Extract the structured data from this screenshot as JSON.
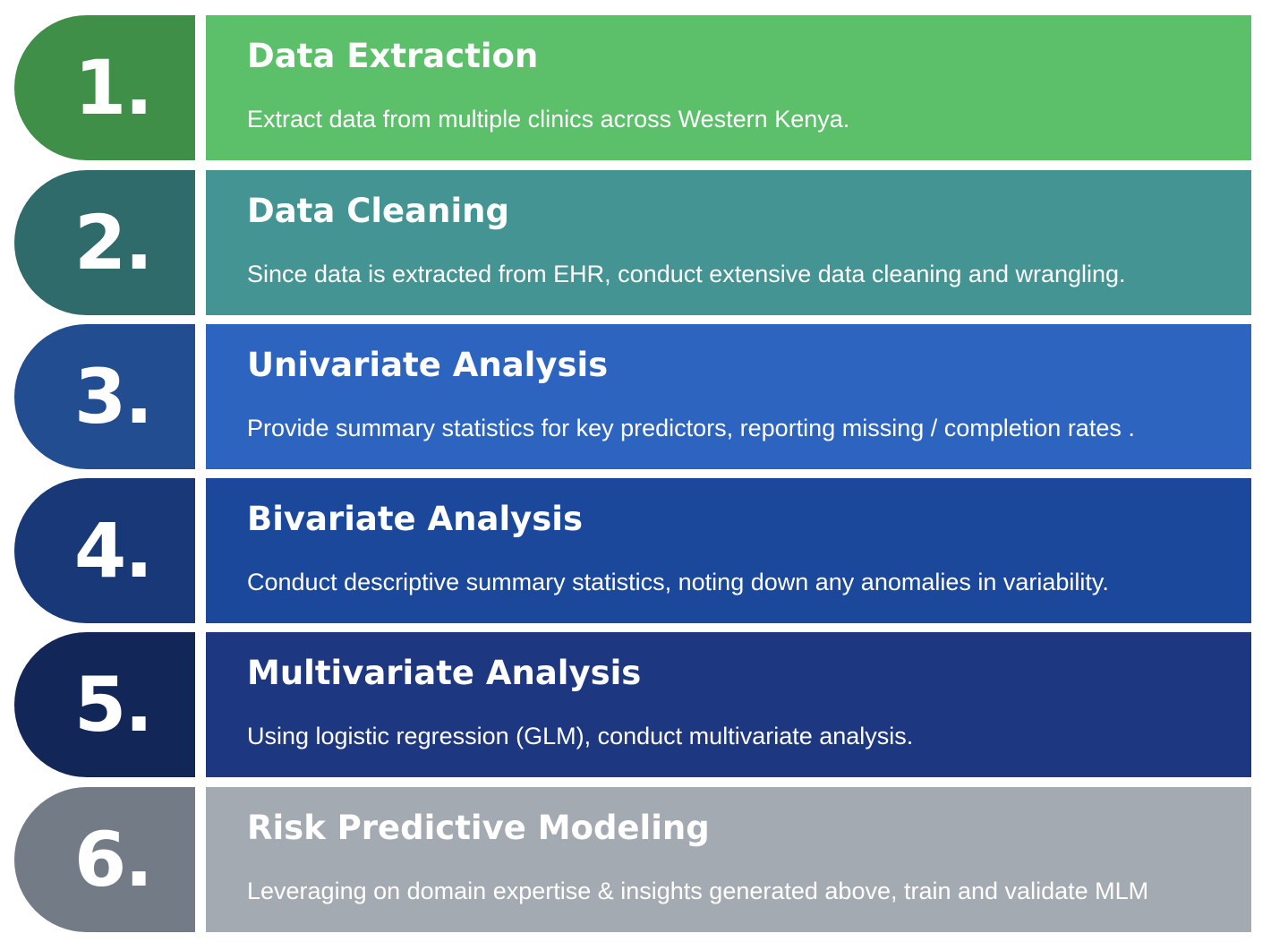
{
  "steps": [
    {
      "number": "1.",
      "title": "Data Extraction",
      "description": "Extract data from multiple clinics across Western Kenya.",
      "tab_color": "#3f8f49",
      "panel_color": "#5cbf6a"
    },
    {
      "number": "2.",
      "title": "Data Cleaning",
      "description": "Since data is extracted from EHR, conduct extensive data cleaning and wrangling.",
      "tab_color": "#2f6b6b",
      "panel_color": "#459494"
    },
    {
      "number": "3.",
      "title": "Univariate Analysis",
      "description": "Provide summary statistics for key predictors, reporting missing / completion rates .",
      "tab_color": "#234d91",
      "panel_color": "#2d64bf"
    },
    {
      "number": "4.",
      "title": "Bivariate Analysis",
      "description": "Conduct descriptive summary statistics, noting down any anomalies in variability.",
      "tab_color": "#183878",
      "panel_color": "#1b489a"
    },
    {
      "number": "5.",
      "title": "Multivariate Analysis",
      "description": "Using logistic regression (GLM), conduct multivariate analysis.",
      "tab_color": "#132658",
      "panel_color": "#1d3781"
    },
    {
      "number": "6.",
      "title": "Risk Predictive Modeling",
      "description": "Leveraging on domain expertise & insights generated above, train and validate MLM",
      "tab_color": "#727b86",
      "panel_color": "#a4aab1"
    }
  ]
}
